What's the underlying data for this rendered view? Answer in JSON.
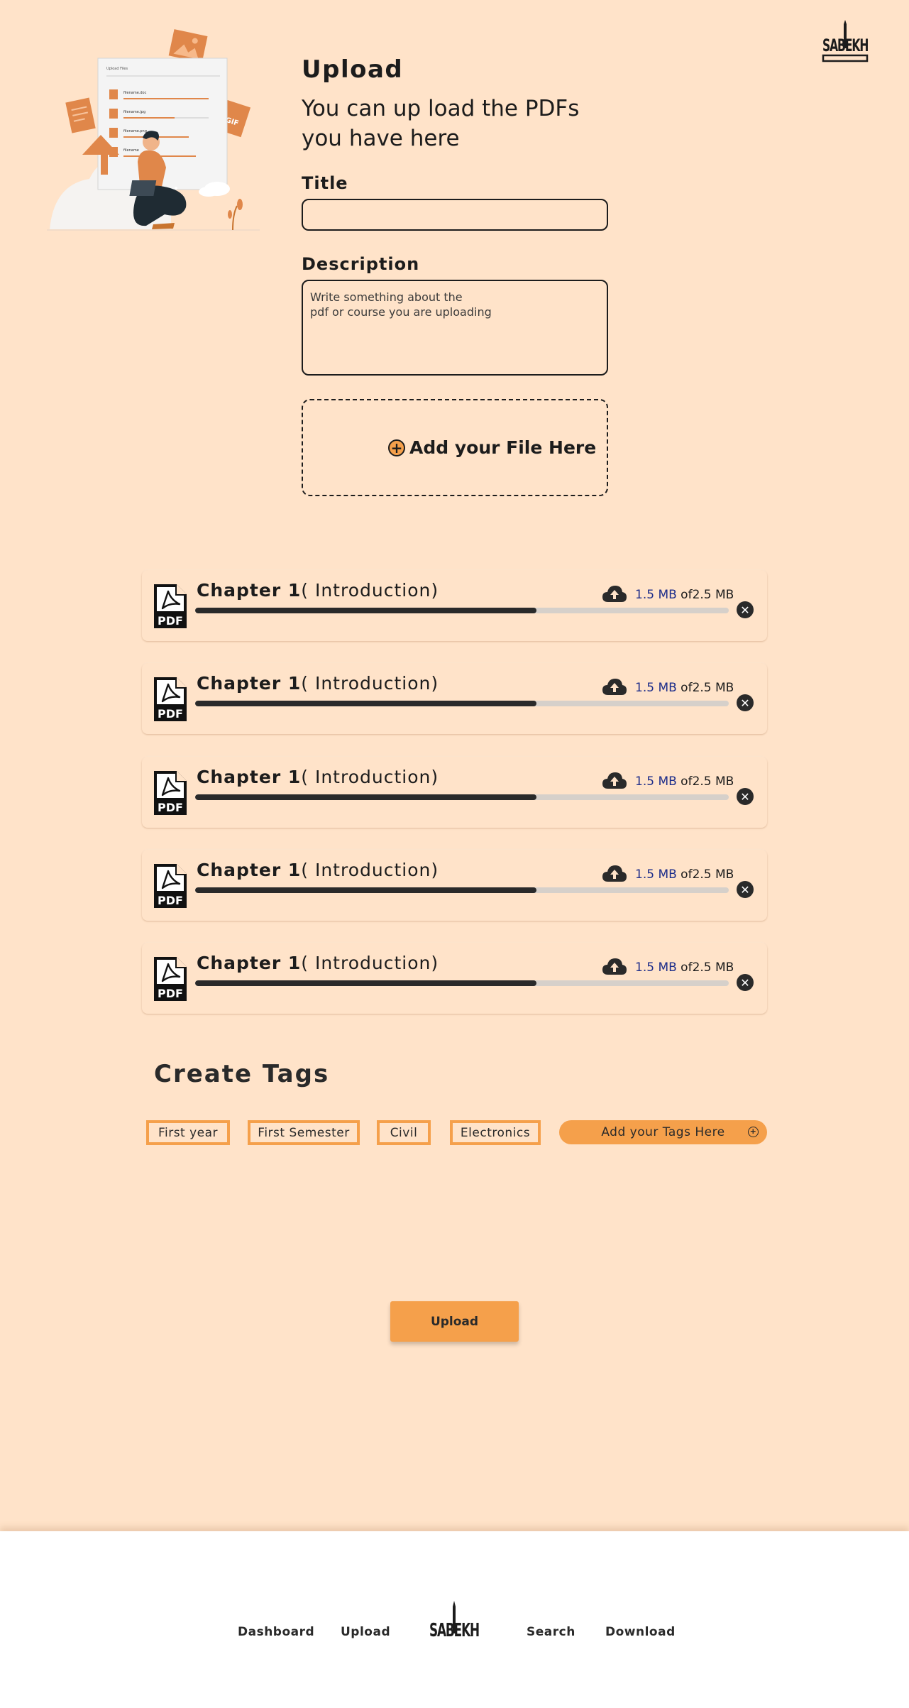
{
  "header": {
    "logo_text": "SABEKH",
    "title": "Upload",
    "subtitle": "You can up load the PDFs you have here"
  },
  "illustration": {
    "panel_title": "Upload Files",
    "files": [
      "filename.doc",
      "filename.jpg",
      "filename.png",
      "filename"
    ]
  },
  "form": {
    "title_label": "Title",
    "title_value": "",
    "description_label": "Description",
    "description_placeholder": "Write something about the\npdf or course you are uploading",
    "dropzone_label": "Add your File Here"
  },
  "files": [
    {
      "name_bold": "Chapter 1",
      "name_rest": "( Introduction)",
      "uploaded": "1.5 MB",
      "of": " of",
      "total": "2.5 MB",
      "progress": 0.64
    },
    {
      "name_bold": "Chapter 1",
      "name_rest": "( Introduction)",
      "uploaded": "1.5 MB",
      "of": " of",
      "total": "2.5 MB",
      "progress": 0.64
    },
    {
      "name_bold": "Chapter 1",
      "name_rest": "( Introduction)",
      "uploaded": "1.5 MB",
      "of": " of",
      "total": "2.5 MB",
      "progress": 0.64
    },
    {
      "name_bold": "Chapter 1",
      "name_rest": "( Introduction)",
      "uploaded": "1.5 MB",
      "of": " of",
      "total": "2.5 MB",
      "progress": 0.64
    },
    {
      "name_bold": "Chapter 1",
      "name_rest": "( Introduction)",
      "uploaded": "1.5 MB",
      "of": " of",
      "total": "2.5 MB",
      "progress": 0.64
    }
  ],
  "file_icon": "pdf-icon",
  "tags": {
    "heading": "Create Tags",
    "items": [
      "First year",
      "First Semester",
      "Civil",
      "Electronics"
    ],
    "add_label": "Add your Tags Here"
  },
  "actions": {
    "upload_label": "Upload"
  },
  "footer": {
    "nav": [
      "Dashboard",
      "Upload",
      "Search",
      "Download"
    ],
    "logo_text": "SABEKH"
  },
  "colors": {
    "background": "#ffe3c9",
    "accent": "#f5a04b",
    "progress": "#2a2a2a",
    "uploaded_size": "#1d2d8a"
  }
}
